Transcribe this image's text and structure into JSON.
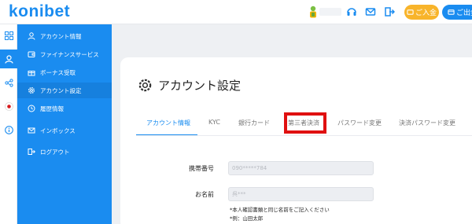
{
  "header": {
    "logo_text": "konibet",
    "deposit_label": "ご入金",
    "withdraw_label": "ご出金"
  },
  "sidebar": {
    "items": [
      {
        "label": "アカウント情報",
        "icon": "user-icon"
      },
      {
        "label": "ファイナンスサービス",
        "icon": "wallet-icon"
      },
      {
        "label": "ボーナス受取",
        "icon": "gift-icon"
      },
      {
        "label": "アカウント設定",
        "icon": "gear-icon"
      },
      {
        "label": "履歴情報",
        "icon": "history-icon"
      },
      {
        "label": "インボックス",
        "icon": "mail-icon"
      },
      {
        "label": "ログアウト",
        "icon": "logout-icon"
      }
    ]
  },
  "page": {
    "title": "アカウント設定"
  },
  "tabs": [
    {
      "label": "アカウント情報"
    },
    {
      "label": "KYC"
    },
    {
      "label": "銀行カード"
    },
    {
      "label": "第三者決済"
    },
    {
      "label": "パスワード変更"
    },
    {
      "label": "決済パスワード変更"
    }
  ],
  "form": {
    "phone_label": "携帯番号",
    "phone_value": "090*****784",
    "name_label": "お名前",
    "name_value": "呉***",
    "note_1": "*本人確認書類と同じ名前をご記入ください",
    "note_2": "*例：山田太郎"
  },
  "colors": {
    "brand_blue": "#1a8cf0",
    "deposit_orange": "#f8b42a",
    "highlight_red": "#e01010"
  }
}
